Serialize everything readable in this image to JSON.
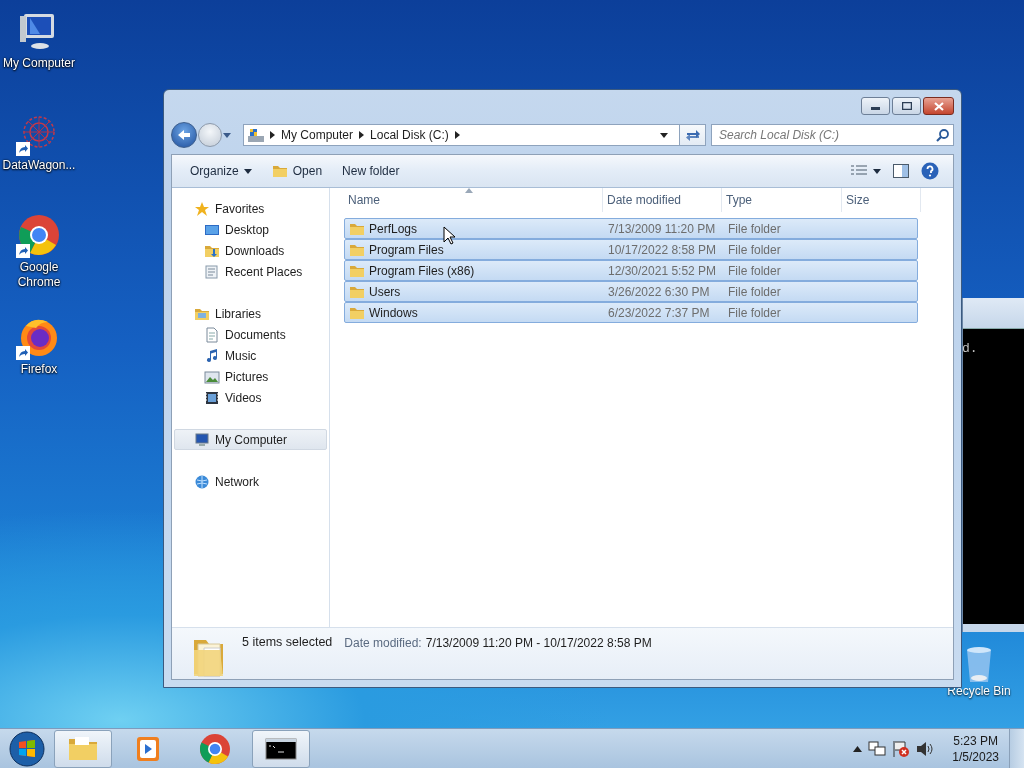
{
  "desktop_icons": [
    {
      "label": "My Computer",
      "kind": "computer",
      "shortcut": false
    },
    {
      "label": "DataWagon...",
      "kind": "datawagon",
      "shortcut": true
    },
    {
      "label": "Google Chrome",
      "kind": "chrome",
      "shortcut": true
    },
    {
      "label": "Firefox",
      "kind": "firefox",
      "shortcut": true
    }
  ],
  "recycle_bin": {
    "label": "Recycle Bin"
  },
  "console_window": {
    "text": "d."
  },
  "explorer": {
    "breadcrumbs": [
      "My Computer",
      "Local Disk (C:)"
    ],
    "search": {
      "placeholder": "Search Local Disk (C:)"
    },
    "toolbar": [
      {
        "label": "Organize",
        "kind": "menu"
      },
      {
        "label": "Open",
        "kind": "open"
      },
      {
        "label": "New folder",
        "kind": "plain"
      }
    ],
    "nav": [
      {
        "label": "Favorites",
        "kind": "star",
        "selected": false,
        "children": [
          {
            "label": "Desktop",
            "kind": "desktop",
            "selected": false
          },
          {
            "label": "Downloads",
            "kind": "downloads",
            "selected": false
          },
          {
            "label": "Recent Places",
            "kind": "recent",
            "selected": false
          }
        ]
      },
      {
        "label": "Libraries",
        "kind": "library",
        "selected": false,
        "children": [
          {
            "label": "Documents",
            "kind": "documents",
            "selected": false
          },
          {
            "label": "Music",
            "kind": "music",
            "selected": false
          },
          {
            "label": "Pictures",
            "kind": "pictures",
            "selected": false
          },
          {
            "label": "Videos",
            "kind": "videos",
            "selected": false
          }
        ]
      },
      {
        "label": "My Computer",
        "kind": "computer",
        "selected": true
      },
      {
        "label": "Network",
        "kind": "network",
        "selected": false
      }
    ],
    "columns": [
      "Name",
      "Date modified",
      "Type",
      "Size"
    ],
    "rows": [
      {
        "name": "PerfLogs",
        "date": "7/13/2009 11:20 PM",
        "type": "File folder",
        "selected": true
      },
      {
        "name": "Program Files",
        "date": "10/17/2022 8:58 PM",
        "type": "File folder",
        "selected": true
      },
      {
        "name": "Program Files (x86)",
        "date": "12/30/2021 5:52 PM",
        "type": "File folder",
        "selected": true
      },
      {
        "name": "Users",
        "date": "3/26/2022 6:30 PM",
        "type": "File folder",
        "selected": true
      },
      {
        "name": "Windows",
        "date": "6/23/2022 7:37 PM",
        "type": "File folder",
        "selected": true
      }
    ],
    "status": {
      "count": "5 items selected",
      "label": "Date modified:",
      "value": "7/13/2009 11:20 PM - 10/17/2022 8:58 PM"
    }
  },
  "taskbar": {
    "items": [
      {
        "kind": "explorer",
        "selected": true
      },
      {
        "kind": "media",
        "selected": false
      },
      {
        "kind": "chrome",
        "selected": false
      },
      {
        "kind": "cmd",
        "selected": true
      }
    ],
    "time": "5:23 PM",
    "date": "1/5/2023"
  }
}
